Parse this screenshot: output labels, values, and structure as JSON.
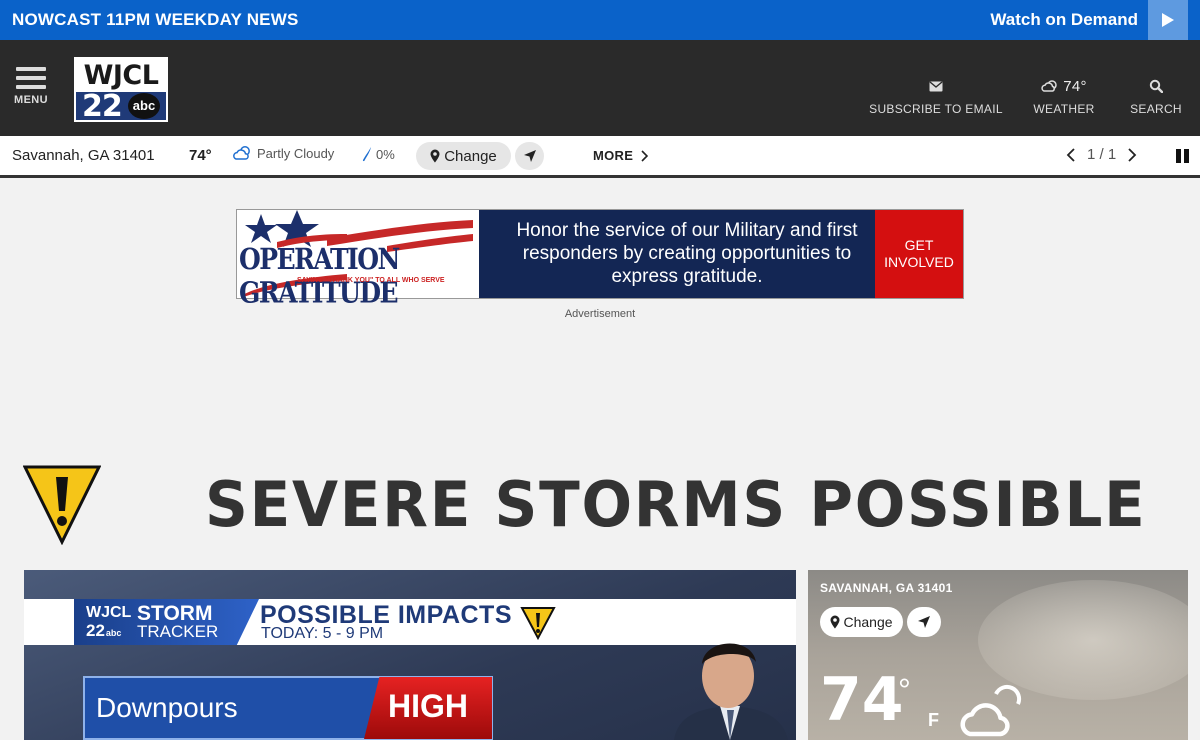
{
  "topbar": {
    "live_text": "NOWCAST 11PM WEEKDAY NEWS",
    "watch_label": "Watch on Demand",
    "play_icon": "play-icon"
  },
  "header": {
    "menu_label": "MENU",
    "logo": {
      "call_letters": "WJCL",
      "channel": "22",
      "network": "abc"
    },
    "subscribe_label": "SUBSCRIBE TO EMAIL",
    "weather_temp": "74°",
    "weather_label": "WEATHER",
    "search_label": "SEARCH"
  },
  "weather_bar": {
    "location": "Savannah, GA 31401",
    "temp": "74°",
    "condition": "Partly Cloudy",
    "precip": "0%",
    "change_label": "Change",
    "more_label": "MORE",
    "pager": "1 / 1"
  },
  "ad": {
    "brand": "OPERATION GRATITUDE",
    "brand_tagline": "SAYING \"THANK YOU\" TO ALL WHO SERVE",
    "message": "Honor the service of our Military and first responders by creating opportunities to express gratitude.",
    "cta": "GET INVOLVED",
    "label": "Advertisement",
    "colors": {
      "panel": "#132654",
      "cta": "#d40f10"
    }
  },
  "alert": {
    "headline": "SEVERE STORMS POSSIBLE",
    "icon": "warning-icon",
    "icon_color": "#f5c518"
  },
  "video": {
    "st_wjcl": "WJCL",
    "st_22": "22",
    "st_abc": "abc",
    "st_storm": "STORM",
    "st_tracker": "TRACKER",
    "impacts_title": "POSSIBLE IMPACTS",
    "impacts_time": "TODAY: 5 - 9 PM",
    "hazard": "Downpours",
    "level": "HIGH"
  },
  "weather_card": {
    "location": "SAVANNAH, GA 31401",
    "change_label": "Change",
    "temp": "74",
    "degree": "°",
    "unit": "F",
    "icon": "partly-cloudy-icon"
  },
  "colors": {
    "accent_blue": "#0a62c9",
    "header_dark": "#2a2a2a"
  }
}
